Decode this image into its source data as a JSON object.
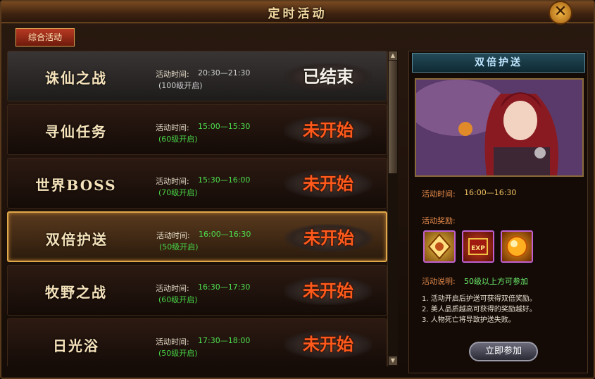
{
  "window": {
    "title": "定时活动",
    "close": "✕"
  },
  "tab": {
    "label": "综合活动"
  },
  "activities": [
    {
      "name": "诛仙之战",
      "time_label": "活动时间:",
      "time": "20:30—21:30",
      "level": "(100级开启)",
      "status": "已结束",
      "state": "done"
    },
    {
      "name": "寻仙任务",
      "time_label": "活动时间:",
      "time": "15:00—15:30",
      "level": "(60级开启)",
      "status": "未开始",
      "state": "pending"
    },
    {
      "name": "世界BOSS",
      "time_label": "活动时间:",
      "time": "15:30—16:00",
      "level": "(70级开启)",
      "status": "未开始",
      "state": "pending"
    },
    {
      "name": "双倍护送",
      "time_label": "活动时间:",
      "time": "16:00—16:30",
      "level": "(50级开启)",
      "status": "未开始",
      "state": "selected"
    },
    {
      "name": "牧野之战",
      "time_label": "活动时间:",
      "time": "16:30—17:30",
      "level": "(60级开启)",
      "status": "未开始",
      "state": "pending"
    },
    {
      "name": "日光浴",
      "time_label": "活动时间:",
      "time": "17:30—18:00",
      "level": "(50级开启)",
      "status": "未开始",
      "state": "pending"
    }
  ],
  "detail": {
    "title": "双倍护送",
    "time_label": "活动时间:",
    "time": "16:00—16:30",
    "reward_label": "活动奖励:",
    "rewards": [
      "gold-seal-icon",
      "exp-scroll-icon",
      "fire-orb-icon"
    ],
    "desc_label": "活动说明:",
    "desc_req": "50级以上方可参加",
    "desc_lines": [
      "1. 活动开启后护送可获得双倍奖励。",
      "2. 美人品质越高可获得的奖励越好。",
      "3. 人物死亡将导致护送失败。"
    ],
    "join_label": "立即参加"
  },
  "colors": {
    "accent": "#e0a84a",
    "status_pending": "#ff5a1c",
    "time_green": "#4ee04e",
    "detail_orange": "#e58a4a"
  }
}
